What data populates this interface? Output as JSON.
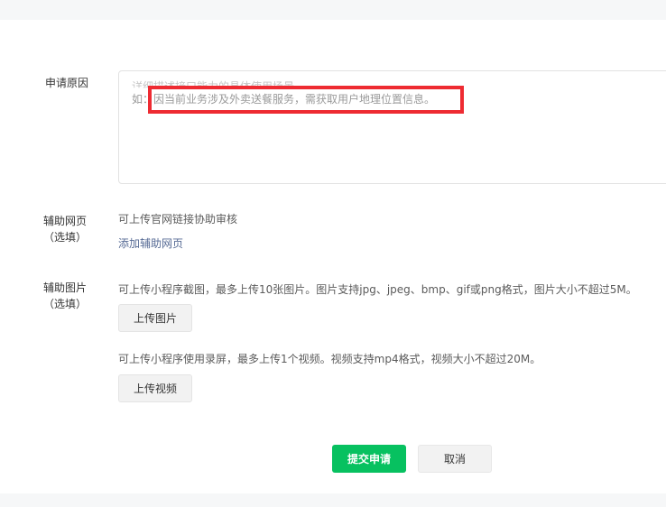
{
  "form": {
    "reason": {
      "label": "申请原因",
      "placeholder_line1": "详细描述接口能力的具体使用场景",
      "placeholder_line2": "如：因当前业务涉及外卖送餐服务，需获取用户地理位置信息。"
    },
    "support_site": {
      "label": "辅助网页",
      "optional": "（选填）",
      "hint": "可上传官网链接协助审核",
      "add_link": "添加辅助网页"
    },
    "support_image": {
      "label": "辅助图片",
      "optional": "（选填）",
      "image_hint": "可上传小程序截图，最多上传10张图片。图片支持jpg、jpeg、bmp、gif或png格式，图片大小不超过5M。",
      "upload_image": "上传图片",
      "video_hint": "可上传小程序使用录屏，最多上传1个视频。视频支持mp4格式，视频大小不超过20M。",
      "upload_video": "上传视频"
    }
  },
  "actions": {
    "submit": "提交申请",
    "cancel": "取消"
  },
  "colors": {
    "primary": "#07c160",
    "link": "#576b95",
    "highlight": "#ee2b32"
  }
}
